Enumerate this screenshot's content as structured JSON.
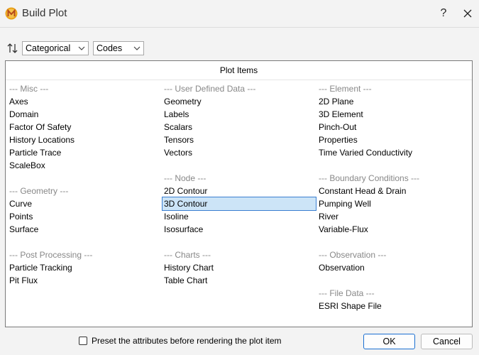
{
  "window": {
    "title": "Build Plot",
    "help_label": "?"
  },
  "toolbar": {
    "sort_icon": "sort-up-down-icon",
    "group_by": {
      "selected": "Categorical"
    },
    "display": {
      "selected": "Codes"
    }
  },
  "panel": {
    "header": "Plot Items",
    "columns": [
      {
        "rows": [
          {
            "text": "--- Misc ---",
            "kind": "header"
          },
          {
            "text": "Axes",
            "kind": "item"
          },
          {
            "text": "Domain",
            "kind": "item"
          },
          {
            "text": "Factor Of Safety",
            "kind": "item"
          },
          {
            "text": "History Locations",
            "kind": "item"
          },
          {
            "text": "Particle Trace",
            "kind": "item"
          },
          {
            "text": "ScaleBox",
            "kind": "item"
          },
          {
            "text": "",
            "kind": "blank"
          },
          {
            "text": "--- Geometry ---",
            "kind": "header"
          },
          {
            "text": "Curve",
            "kind": "item"
          },
          {
            "text": "Points",
            "kind": "item"
          },
          {
            "text": "Surface",
            "kind": "item"
          },
          {
            "text": "",
            "kind": "blank"
          },
          {
            "text": "--- Post Processing ---",
            "kind": "header"
          },
          {
            "text": "Particle Tracking",
            "kind": "item"
          },
          {
            "text": "Pit Flux",
            "kind": "item"
          }
        ]
      },
      {
        "rows": [
          {
            "text": "--- User Defined Data ---",
            "kind": "header"
          },
          {
            "text": "Geometry",
            "kind": "item"
          },
          {
            "text": "Labels",
            "kind": "item"
          },
          {
            "text": "Scalars",
            "kind": "item"
          },
          {
            "text": "Tensors",
            "kind": "item"
          },
          {
            "text": "Vectors",
            "kind": "item"
          },
          {
            "text": "",
            "kind": "blank"
          },
          {
            "text": "--- Node ---",
            "kind": "header"
          },
          {
            "text": "2D Contour",
            "kind": "item"
          },
          {
            "text": "3D Contour",
            "kind": "item",
            "selected": true
          },
          {
            "text": "Isoline",
            "kind": "item"
          },
          {
            "text": "Isosurface",
            "kind": "item"
          },
          {
            "text": "",
            "kind": "blank"
          },
          {
            "text": "--- Charts ---",
            "kind": "header"
          },
          {
            "text": "History Chart",
            "kind": "item"
          },
          {
            "text": "Table Chart",
            "kind": "item"
          }
        ]
      },
      {
        "rows": [
          {
            "text": "--- Element ---",
            "kind": "header"
          },
          {
            "text": "2D Plane",
            "kind": "item"
          },
          {
            "text": "3D Element",
            "kind": "item"
          },
          {
            "text": "Pinch-Out",
            "kind": "item"
          },
          {
            "text": "Properties",
            "kind": "item"
          },
          {
            "text": "Time Varied Conductivity",
            "kind": "item"
          },
          {
            "text": "",
            "kind": "blank"
          },
          {
            "text": "--- Boundary Conditions ---",
            "kind": "header"
          },
          {
            "text": "Constant Head & Drain",
            "kind": "item"
          },
          {
            "text": "Pumping Well",
            "kind": "item"
          },
          {
            "text": "River",
            "kind": "item"
          },
          {
            "text": "Variable-Flux",
            "kind": "item"
          },
          {
            "text": "",
            "kind": "blank"
          },
          {
            "text": "--- Observation ---",
            "kind": "header"
          },
          {
            "text": "Observation",
            "kind": "item"
          },
          {
            "text": "",
            "kind": "blank"
          },
          {
            "text": "--- File Data ---",
            "kind": "header"
          },
          {
            "text": "ESRI Shape File",
            "kind": "item"
          }
        ]
      }
    ]
  },
  "footer": {
    "preset_label": "Preset the attributes before rendering the plot item",
    "preset_checked": false,
    "ok_label": "OK",
    "cancel_label": "Cancel"
  },
  "colors": {
    "selection_bg": "#cce4f7",
    "selection_border": "#3b7fd1",
    "primary_border": "#1a6fd1",
    "header_text": "#888888"
  }
}
